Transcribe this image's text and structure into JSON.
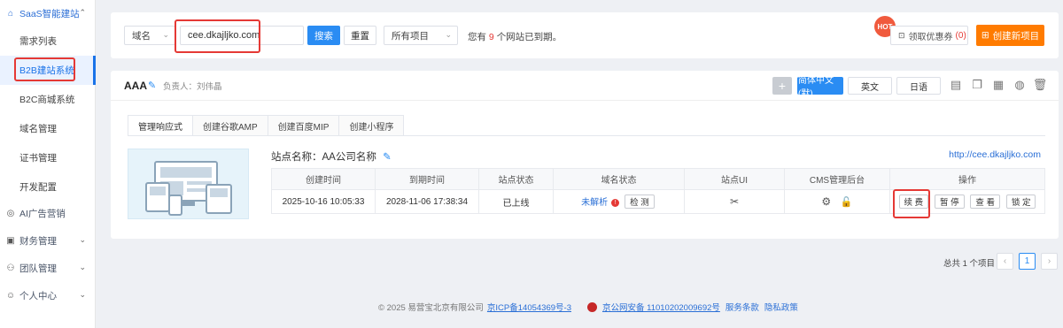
{
  "sidebar": {
    "groups": [
      {
        "label": "SaaS智能建站",
        "icon": "home-icon",
        "expanded": true
      },
      {
        "label": "AI广告营销",
        "icon": "ai-icon"
      },
      {
        "label": "财务管理",
        "icon": "wallet-icon"
      },
      {
        "label": "团队管理",
        "icon": "team-icon"
      },
      {
        "label": "个人中心",
        "icon": "user-icon"
      }
    ],
    "items": [
      {
        "label": "需求列表"
      },
      {
        "label": "B2B建站系统",
        "selected": true
      },
      {
        "label": "B2C商城系统"
      },
      {
        "label": "域名管理"
      },
      {
        "label": "证书管理"
      },
      {
        "label": "开发配置"
      }
    ]
  },
  "search": {
    "field_select": "域名",
    "query": "cee.dkajljko.com",
    "search_label": "搜索",
    "reset_label": "重置",
    "project_select": "所有项目",
    "expire_prefix": "您有",
    "expire_count": "9",
    "expire_suffix": "个网站已到期。",
    "hot_badge": "HOT",
    "coupon_label": "领取优惠券",
    "coupon_count": "0",
    "create_label": "创建新项目"
  },
  "project": {
    "name": "AAA",
    "owner": "负责人：刘伟晶",
    "languages": [
      {
        "label": "简体中文(默)",
        "active": true
      },
      {
        "label": "英文"
      },
      {
        "label": "日语"
      }
    ],
    "tabs": [
      "管理响应式",
      "创建谷歌AMP",
      "创建百度MIP",
      "创建小程序"
    ],
    "site_name": "站点名称：AA公司名称",
    "site_url": "http://cee.dkajljko.com",
    "table": {
      "headers": [
        "创建时间",
        "到期时间",
        "站点状态",
        "域名状态",
        "站点UI",
        "CMS管理后台",
        "操作"
      ],
      "row": {
        "created": "2025-10-16 10:05:33",
        "expires": "2028-11-06 17:38:34",
        "status": "已上线",
        "domain_status": "未解析",
        "check_label": "检 测",
        "actions": [
          "续 费",
          "暂 停",
          "查 看",
          "锁 定"
        ]
      }
    }
  },
  "pagination": {
    "summary": "总共 1 个项目",
    "prev": "‹",
    "current": "1",
    "next": "›"
  },
  "footer": {
    "copyright": "© 2025 易营宝北京有限公司",
    "icp": "京ICP备14054369号-3",
    "police": "京公网安备 11010202009692号",
    "terms": "服务条款",
    "privacy": "隐私政策"
  },
  "colors": {
    "accent": "#2a8cf3",
    "orange": "#ff7b00",
    "highlight": "#e53935"
  }
}
